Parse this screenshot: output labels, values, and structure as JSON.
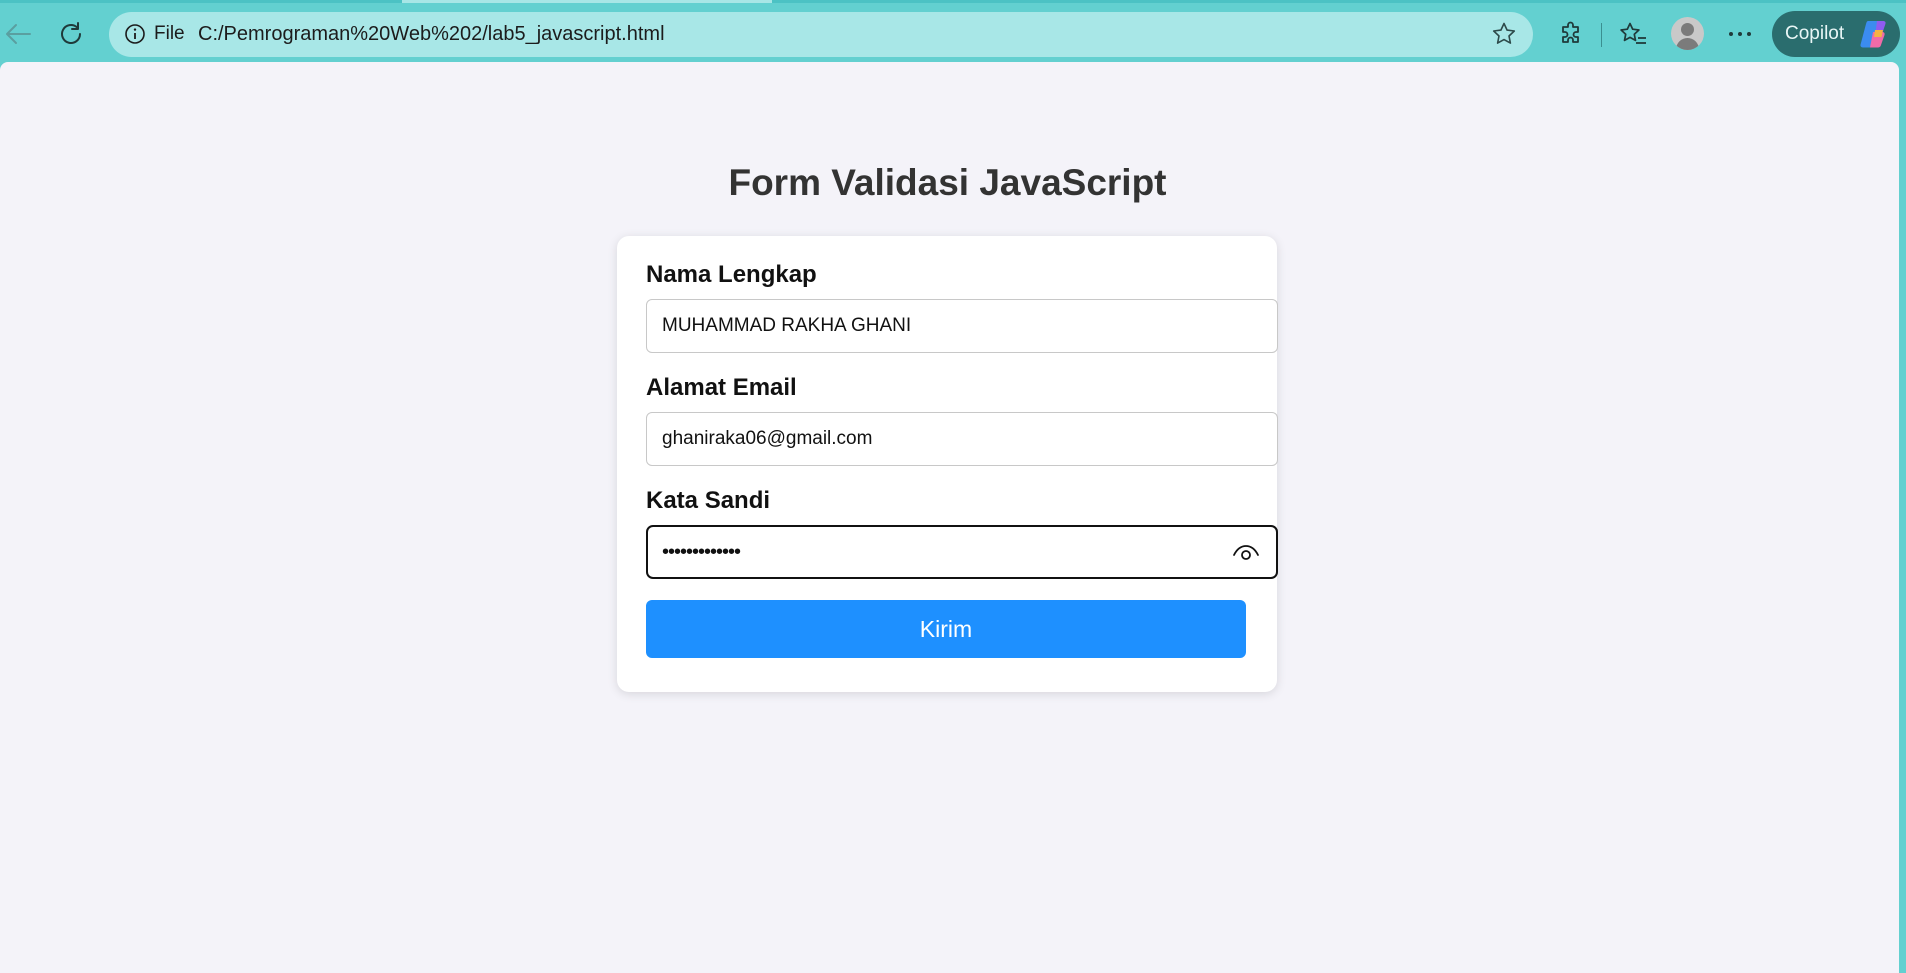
{
  "browser": {
    "info_label": "File",
    "url": "C:/Pemrograman%20Web%202/lab5_javascript.html",
    "copilot_label": "Copilot",
    "icons": [
      "back-icon",
      "refresh-icon",
      "info-icon",
      "favorite-star-icon",
      "extensions-icon",
      "favorites-icon",
      "profile-avatar",
      "more-icon",
      "copilot-icon"
    ]
  },
  "page": {
    "title": "Form Validasi JavaScript",
    "form": {
      "name_label": "Nama Lengkap",
      "name_value": "MUHAMMAD RAKHA GHANI",
      "email_label": "Alamat Email",
      "email_value": "ghaniraka06@gmail.com",
      "password_label": "Kata Sandi",
      "password_value": "•••••••••••••",
      "submit_label": "Kirim"
    }
  },
  "colors": {
    "toolbar_bg": "#63d0d0",
    "address_bg": "#a8e7e7",
    "page_bg": "#f4f3f9",
    "button_bg": "#1e90ff"
  }
}
